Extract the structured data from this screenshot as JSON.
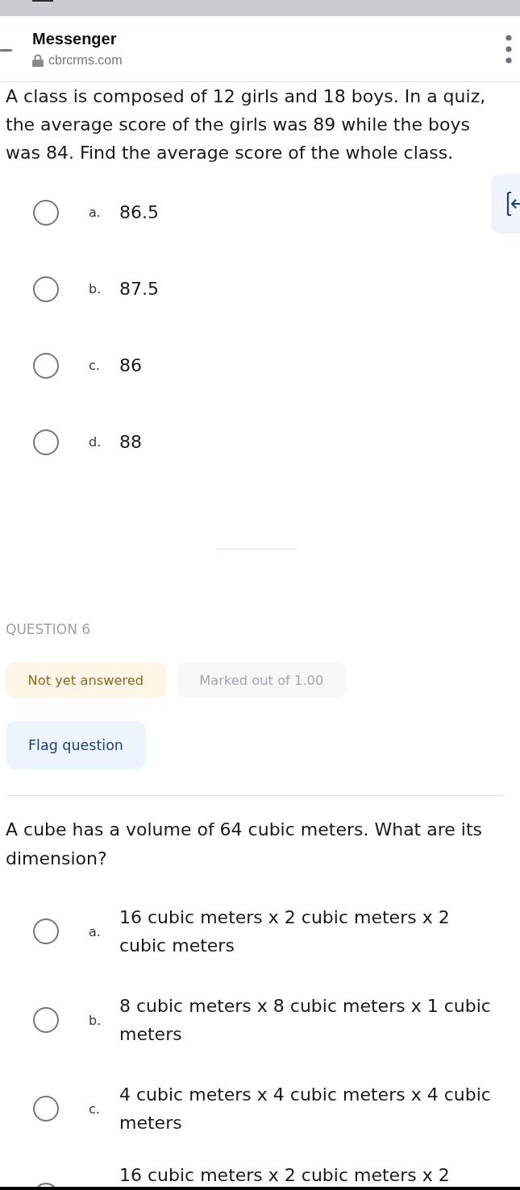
{
  "browser_header": {
    "title": "Messenger",
    "url": "cbrcrms.com"
  },
  "questions": [
    {
      "text": "A class is composed of 12 girls and 18 boys. In a quiz, the average score of the girls was 89 while the boys was 84. Find the average score of the whole class.",
      "options": [
        {
          "letter": "a.",
          "text": "86.5",
          "selected": false
        },
        {
          "letter": "b.",
          "text": "87.5",
          "selected": false
        },
        {
          "letter": "c.",
          "text": "86",
          "selected": false
        },
        {
          "letter": "d.",
          "text": "88",
          "selected": false
        }
      ]
    },
    {
      "number": "QUESTION 6",
      "status": "Not yet answered",
      "marks": "Marked out of 1.00",
      "flag_button": "Flag question",
      "text": "A cube has a volume of 64 cubic meters. What are its dimension?",
      "options": [
        {
          "letter": "a.",
          "text": "16 cubic meters x 2 cubic meters x 2 cubic meters",
          "selected": false
        },
        {
          "letter": "b.",
          "text": "8 cubic meters x 8 cubic meters x 1 cubic meters",
          "selected": false
        },
        {
          "letter": "c.",
          "text": "4 cubic meters x 4 cubic meters x 4 cubic meters",
          "selected": false
        },
        {
          "text": "16 cubic meters x 2 cubic meters x 2",
          "selected": false
        }
      ]
    }
  ]
}
